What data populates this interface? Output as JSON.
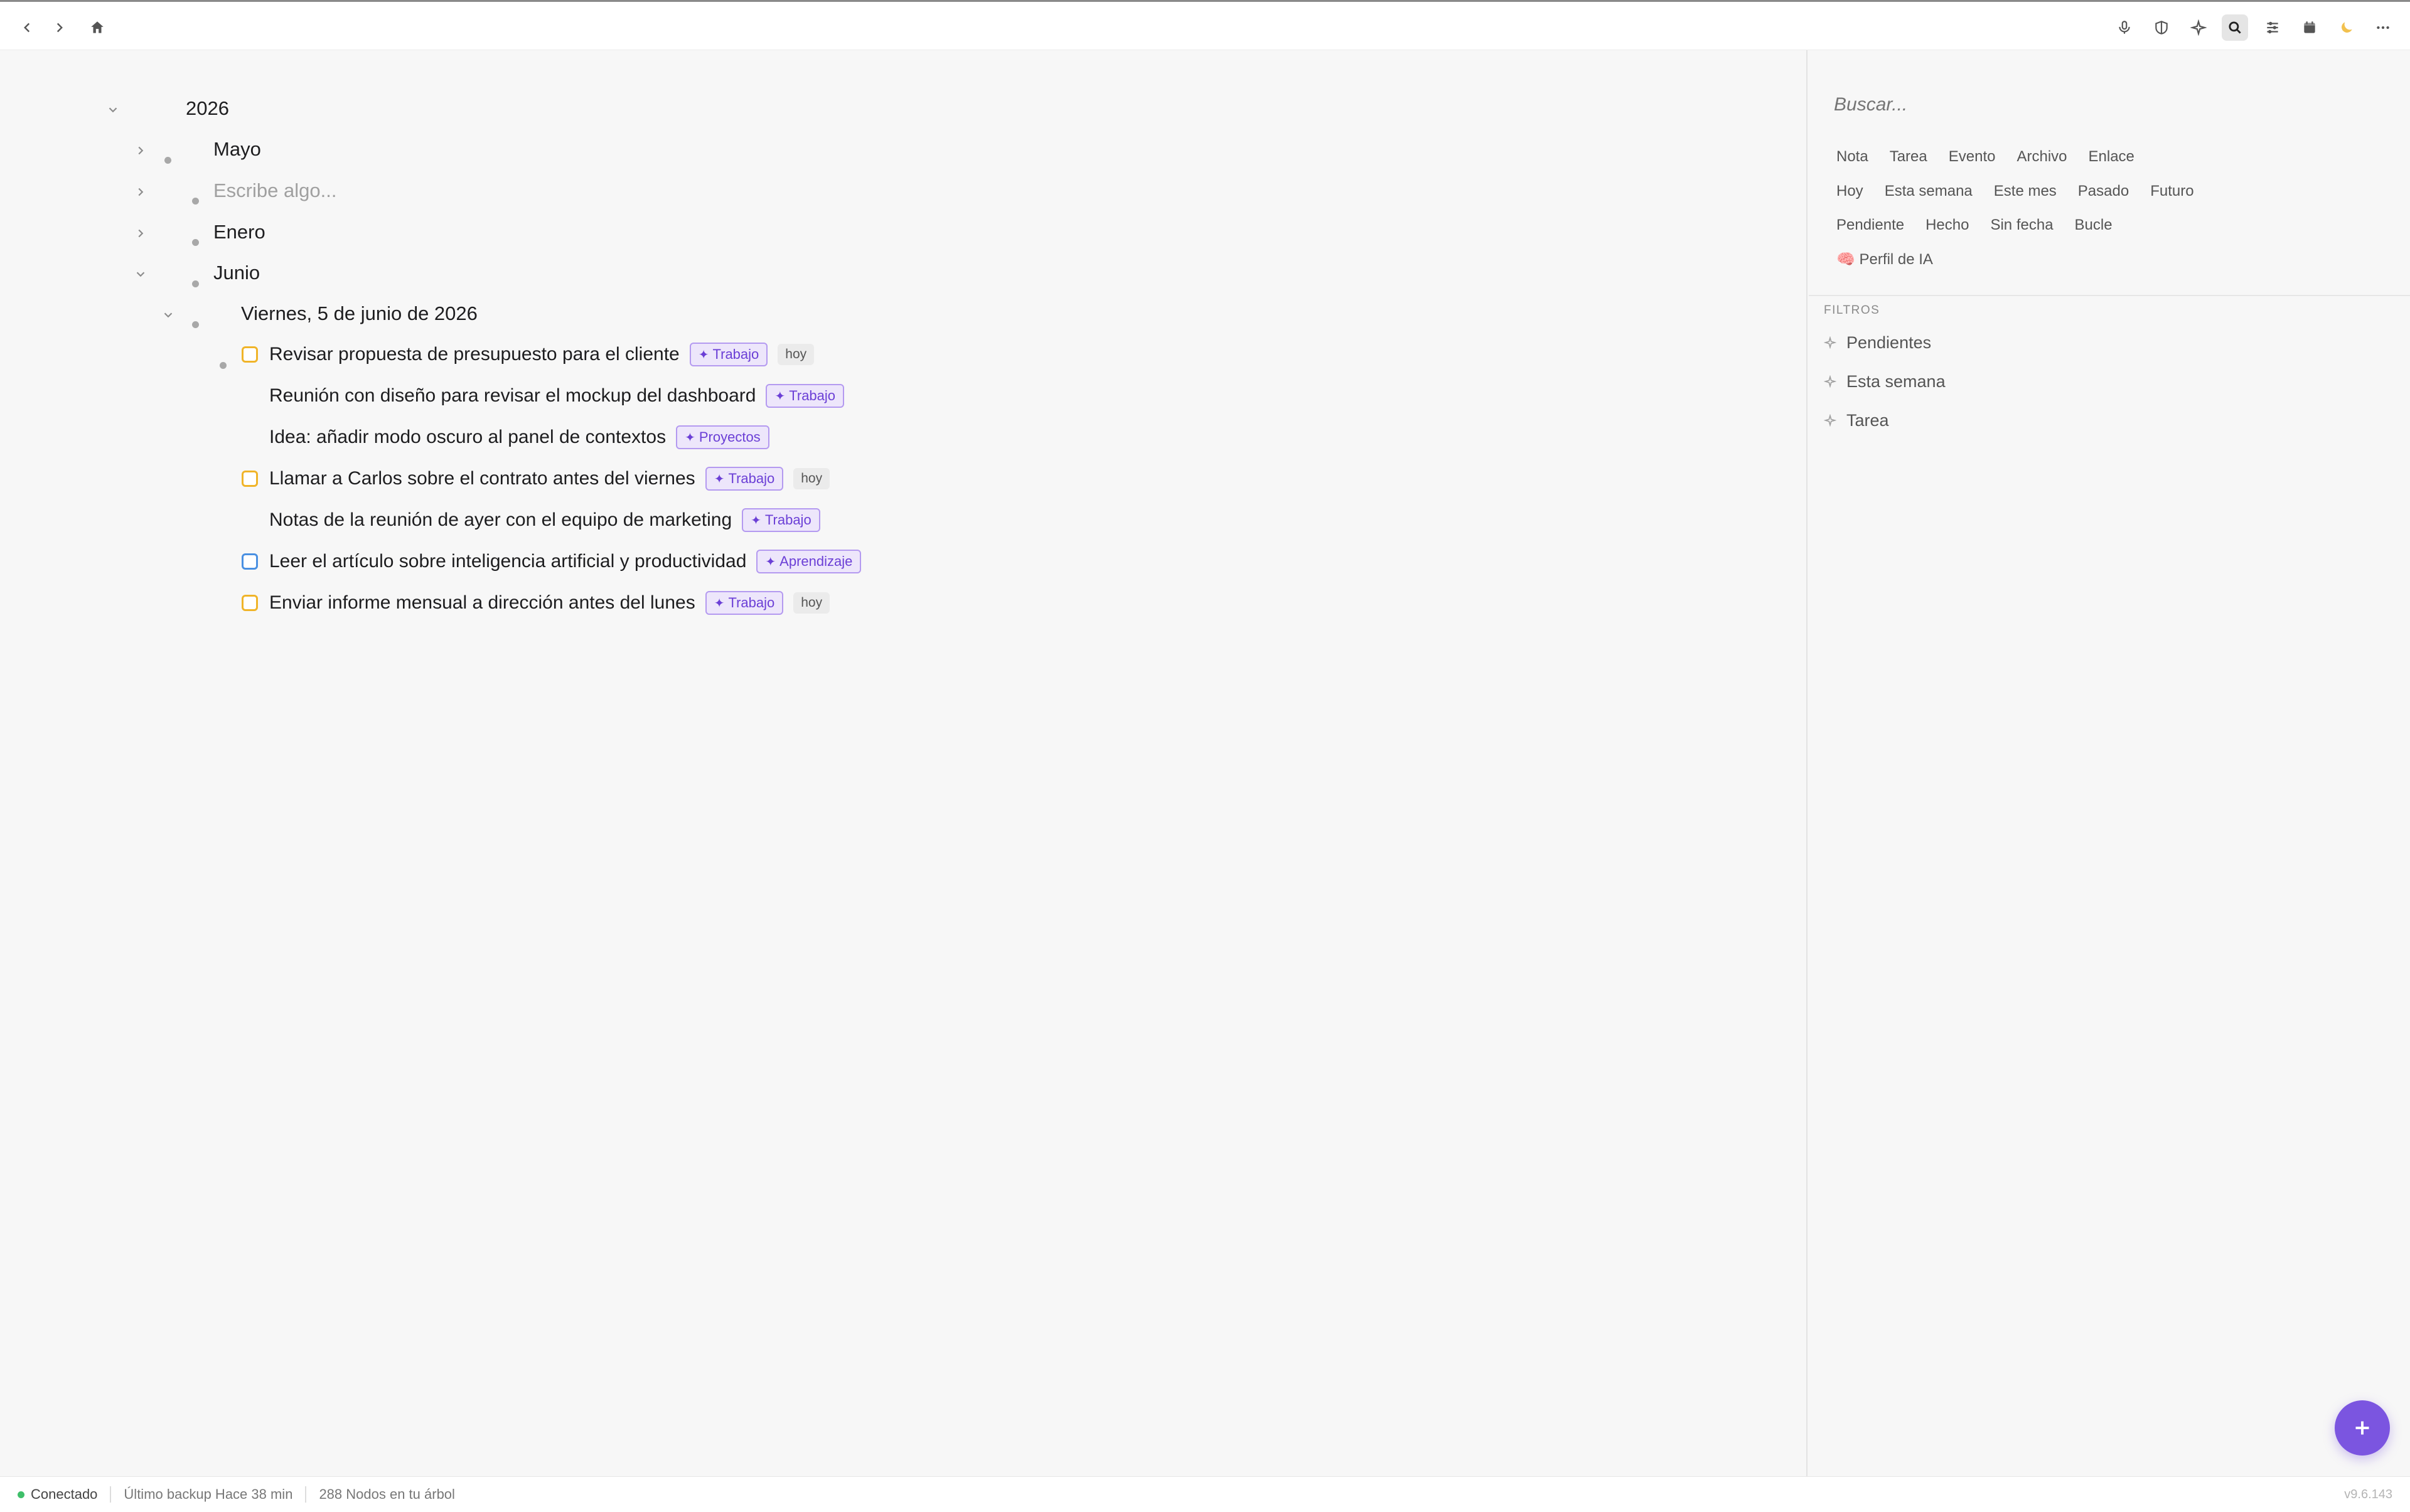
{
  "toolbar": {
    "left_icons": [
      "chevron-left-icon",
      "chevron-right-icon",
      "home-icon"
    ],
    "right_icons": [
      "microphone-icon",
      "shield-icon",
      "sparkle-icon",
      "search-icon",
      "sliders-icon",
      "calendar-icon",
      "moon-icon",
      "more-icon"
    ],
    "active_icon": "search-icon"
  },
  "tree": {
    "year": "2026",
    "months": [
      {
        "label": "Mayo",
        "placeholder": false
      },
      {
        "label": "Escribe algo...",
        "placeholder": true
      },
      {
        "label": "Enero",
        "placeholder": false
      },
      {
        "label": "Junio",
        "placeholder": false
      }
    ],
    "day": "Viernes, 5 de junio de 2026",
    "items": [
      {
        "text": "Revisar propuesta de presupuesto para el cliente",
        "tag": "Trabajo",
        "badge": "hoy",
        "checkbox": "yellow"
      },
      {
        "text": "Reunión con diseño para revisar el mockup del dashboard",
        "tag": "Trabajo",
        "badge": "",
        "checkbox": "none"
      },
      {
        "text": "Idea: añadir modo oscuro al panel de contextos",
        "tag": "Proyectos",
        "badge": "",
        "checkbox": "none"
      },
      {
        "text": "Llamar a Carlos sobre el contrato antes del viernes",
        "tag": "Trabajo",
        "badge": "hoy",
        "checkbox": "yellow"
      },
      {
        "text": "Notas de la reunión de ayer con el equipo de marketing",
        "tag": "Trabajo",
        "badge": "",
        "checkbox": "none"
      },
      {
        "text": "Leer el artículo sobre inteligencia artificial y productividad",
        "tag": "Aprendizaje",
        "badge": "",
        "checkbox": "blue"
      },
      {
        "text": "Enviar informe mensual a dirección antes del lunes",
        "tag": "Trabajo",
        "badge": "hoy",
        "checkbox": "yellow"
      }
    ],
    "tag_star": "✦"
  },
  "sidebar": {
    "search_placeholder": "Buscar...",
    "type_chips": [
      "Nota",
      "Tarea",
      "Evento",
      "Archivo",
      "Enlace"
    ],
    "date_chips": [
      "Hoy",
      "Esta semana",
      "Este mes",
      "Pasado",
      "Futuro"
    ],
    "status_chips": [
      "Pendiente",
      "Hecho",
      "Sin fecha",
      "Bucle"
    ],
    "ai_profile": "🧠 Perfil de IA",
    "filters_title": "FILTROS",
    "filters": [
      "Pendientes",
      "Esta semana",
      "Tarea"
    ]
  },
  "statusbar": {
    "connection": "Conectado",
    "backup": "Último backup Hace 38 min",
    "nodes": "288 Nodos en tu árbol",
    "version": "v9.6.143"
  },
  "colors": {
    "accent": "#7b55e0",
    "tag_bg": "#ede6fb",
    "tag_border": "#b49af0",
    "checkbox_yellow": "#f0b429",
    "checkbox_blue": "#4a90e2",
    "status_green": "#3fbf6a"
  }
}
